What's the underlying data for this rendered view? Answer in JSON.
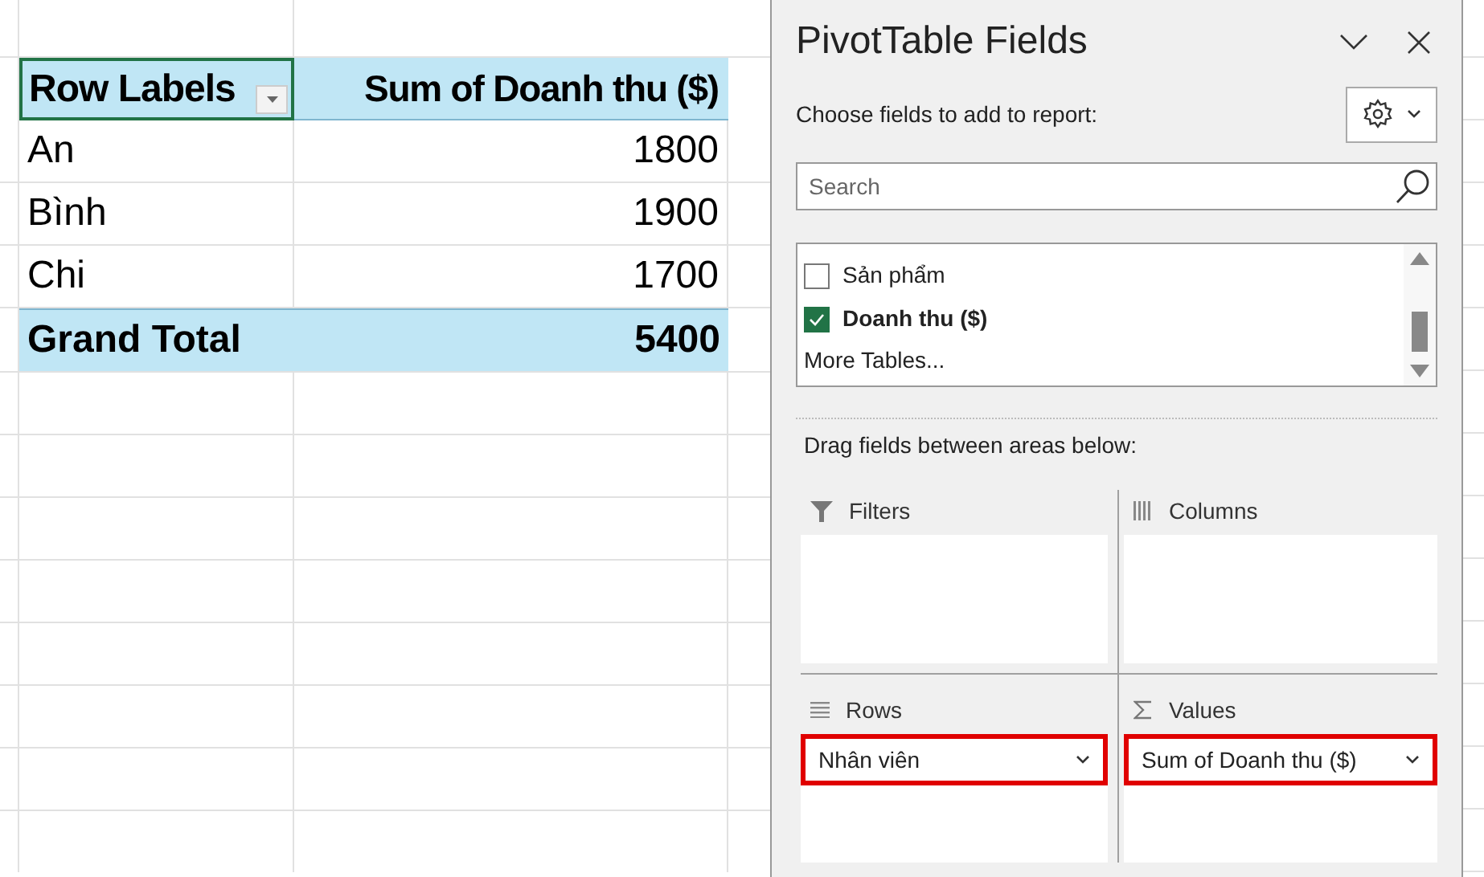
{
  "sheet": {
    "header": {
      "label": "Row Labels",
      "value": "Sum of Doanh thu ($)",
      "selected": true
    },
    "rows": [
      {
        "label": "An",
        "value": "1800"
      },
      {
        "label": "Bình",
        "value": "1900"
      },
      {
        "label": "Chi",
        "value": "1700"
      }
    ],
    "total": {
      "label": "Grand Total",
      "value": "5400"
    }
  },
  "panel": {
    "title": "PivotTable Fields",
    "choose_label": "Choose fields to add to report:",
    "search": {
      "placeholder": "Search"
    },
    "fields": [
      {
        "label": "Sản phẩm",
        "checked": false
      },
      {
        "label": "Doanh thu ($)",
        "checked": true
      }
    ],
    "more_tables": "More Tables...",
    "drag_label": "Drag fields between areas below:",
    "areas": [
      {
        "kind": "filters",
        "label": "Filters"
      },
      {
        "kind": "columns",
        "label": "Columns"
      },
      {
        "kind": "rows",
        "label": "Rows",
        "items": [
          {
            "label": "Nhân viên",
            "highlighted": true
          }
        ]
      },
      {
        "kind": "values",
        "label": "Values",
        "items": [
          {
            "label": "Sum of Doanh thu ($)",
            "highlighted": true
          }
        ]
      }
    ]
  }
}
